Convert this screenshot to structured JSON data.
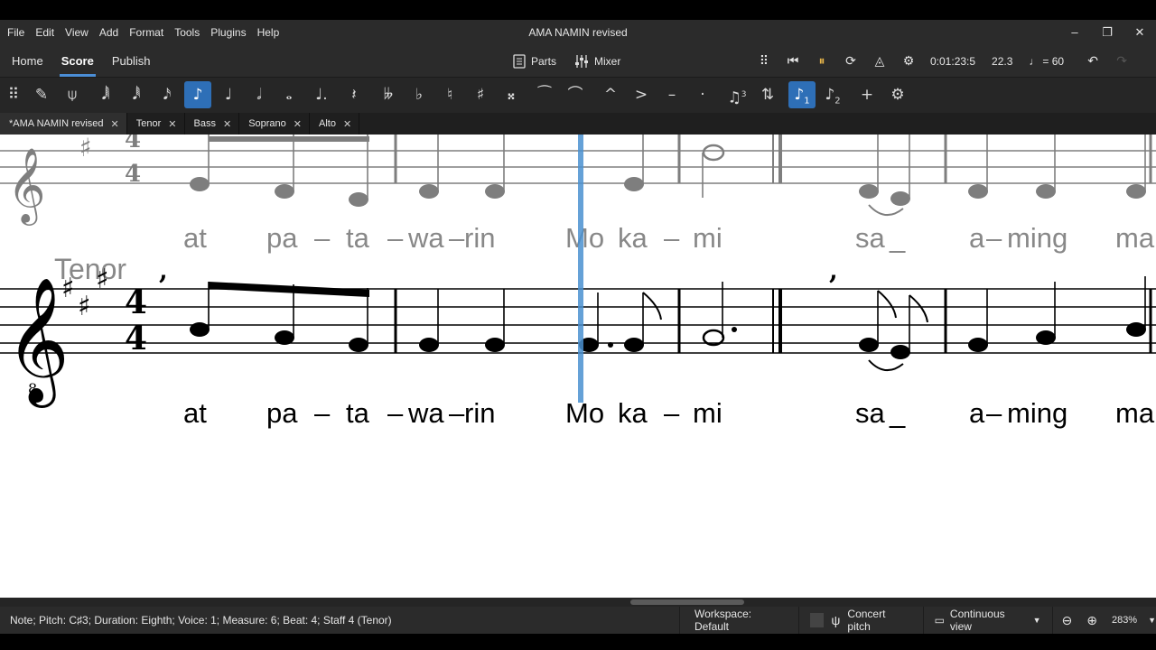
{
  "window": {
    "title": "AMA NAMIN revised"
  },
  "menu": [
    "File",
    "Edit",
    "View",
    "Add",
    "Format",
    "Tools",
    "Plugins",
    "Help"
  ],
  "nav": {
    "tabs": [
      "Home",
      "Score",
      "Publish"
    ],
    "active_tab": "Score",
    "parts_label": "Parts",
    "mixer_label": "Mixer",
    "playback_time": "0:01:23:5",
    "playback_position": "22.3",
    "tempo": "= 60"
  },
  "toolbar": {
    "duration_selected": "eighth-note",
    "icons": [
      "toolbar-grip-icon",
      "note-input-icon",
      "pitch-icon",
      "64th-note-icon",
      "32nd-note-icon",
      "16th-note-icon",
      "eighth-note-icon",
      "quarter-note-icon",
      "half-note-icon",
      "whole-note-icon",
      "augmentation-dot-icon",
      "rest-icon",
      "double-flat-icon",
      "flat-icon",
      "natural-icon",
      "sharp-icon",
      "double-sharp-icon",
      "tie-icon",
      "slur-icon",
      "marcato-icon",
      "accent-icon",
      "tenuto-icon",
      "staccato-icon",
      "tuplet-icon",
      "flip-direction-icon",
      "voice-1-icon",
      "voice-2-icon",
      "add-icon",
      "customize-toolbar-icon"
    ],
    "voice1": "1",
    "voice2": "2",
    "tuplet": "3"
  },
  "doc_tabs": [
    {
      "label": "*AMA NAMIN revised",
      "active": true
    },
    {
      "label": "Tenor",
      "active": false
    },
    {
      "label": "Bass",
      "active": false
    },
    {
      "label": "Soprano",
      "active": false
    },
    {
      "label": "Alto",
      "active": false
    }
  ],
  "score": {
    "staff_name": "Tenor",
    "time_signature": {
      "numerator": "4",
      "denominator": "4"
    },
    "clef_octave": "8",
    "lyrics": [
      "at",
      "pa",
      "–",
      "ta",
      "–",
      "wa",
      "–",
      "rin",
      "Mo",
      "ka",
      "–",
      "mi",
      "sa",
      "_",
      "a",
      "–",
      "ming",
      "ma"
    ]
  },
  "status": {
    "message": "Note; Pitch: C♯3; Duration: Eighth; Voice: 1; Measure: 6; Beat: 4; Staff 4 (Tenor)",
    "workspace": "Workspace: Default",
    "concert_pitch": "Concert pitch",
    "view_mode": "Continuous view",
    "zoom": "283%"
  },
  "colors": {
    "accent": "#4b8ed6",
    "selection": "#2e6fb7",
    "chrome": "#2b2b2b",
    "score_bg": "#ffffff"
  }
}
